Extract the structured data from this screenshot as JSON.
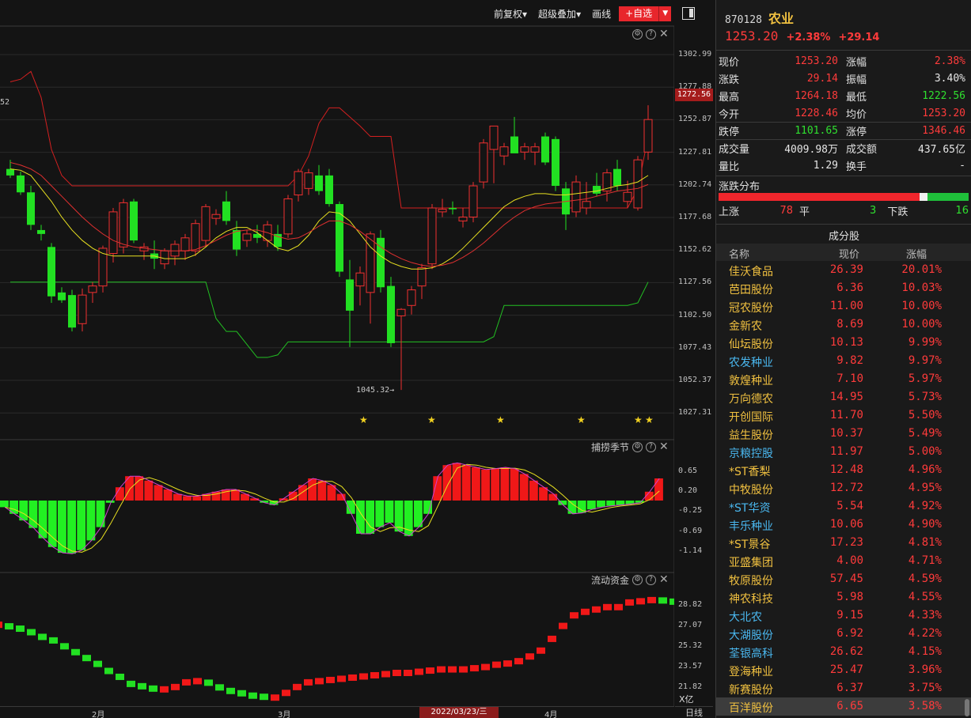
{
  "toolbar": {
    "restore_rights": "前复权",
    "overlay": "超级叠加",
    "draw_line": "画线",
    "add_favorite": "+自选"
  },
  "stock": {
    "code": "870128",
    "name": "农业",
    "price": "1253.20",
    "change_pct": "+2.38%",
    "change": "+29.14"
  },
  "quote": [
    {
      "k1": "现价",
      "v1": "1253.20",
      "c1": "red",
      "k2": "涨幅",
      "v2": "2.38%",
      "c2": "red",
      "div": false
    },
    {
      "k1": "涨跌",
      "v1": "29.14",
      "c1": "red",
      "k2": "振幅",
      "v2": "3.40%",
      "c2": "white",
      "div": false
    },
    {
      "k1": "最高",
      "v1": "1264.18",
      "c1": "red",
      "k2": "最低",
      "v2": "1222.56",
      "c2": "green",
      "div": false
    },
    {
      "k1": "今开",
      "v1": "1228.46",
      "c1": "red",
      "k2": "均价",
      "v2": "1253.20",
      "c2": "red",
      "div": false
    },
    {
      "k1": "跌停",
      "v1": "1101.65",
      "c1": "green",
      "k2": "涨停",
      "v2": "1346.46",
      "c2": "red",
      "div": true
    },
    {
      "k1": "成交量",
      "v1": "4009.98万",
      "c1": "white",
      "k2": "成交额",
      "v2": "437.65亿",
      "c2": "white",
      "div": true
    },
    {
      "k1": "量比",
      "v1": "1.29",
      "c1": "white",
      "k2": "换手",
      "v2": "-",
      "c2": "white",
      "div": false
    }
  ],
  "distribution": {
    "title": "涨跌分布",
    "up_label": "上涨",
    "up": 78,
    "flat_label": "平",
    "flat": 3,
    "down_label": "下跌",
    "down": 16
  },
  "constituents": {
    "title": "成分股",
    "headers": [
      "名称",
      "现价",
      "涨幅"
    ],
    "rows": [
      {
        "name": "佳沃食品",
        "price": "26.39",
        "chg": "20.01%",
        "blue": false
      },
      {
        "name": "芭田股份",
        "price": "6.36",
        "chg": "10.03%",
        "blue": false
      },
      {
        "name": "冠农股份",
        "price": "11.00",
        "chg": "10.00%",
        "blue": false
      },
      {
        "name": "金新农",
        "price": "8.69",
        "chg": "10.00%",
        "blue": false
      },
      {
        "name": "仙坛股份",
        "price": "10.13",
        "chg": "9.99%",
        "blue": false
      },
      {
        "name": "农发种业",
        "price": "9.82",
        "chg": "9.97%",
        "blue": true
      },
      {
        "name": "敦煌种业",
        "price": "7.10",
        "chg": "5.97%",
        "blue": false
      },
      {
        "name": "万向德农",
        "price": "14.95",
        "chg": "5.73%",
        "blue": false
      },
      {
        "name": "开创国际",
        "price": "11.70",
        "chg": "5.50%",
        "blue": false
      },
      {
        "name": "益生股份",
        "price": "10.37",
        "chg": "5.49%",
        "blue": false
      },
      {
        "name": "京粮控股",
        "price": "11.97",
        "chg": "5.00%",
        "blue": true
      },
      {
        "name": "*ST香梨",
        "price": "12.48",
        "chg": "4.96%",
        "blue": false
      },
      {
        "name": "中牧股份",
        "price": "12.72",
        "chg": "4.95%",
        "blue": false
      },
      {
        "name": "*ST华资",
        "price": "5.54",
        "chg": "4.92%",
        "blue": true
      },
      {
        "name": "丰乐种业",
        "price": "10.06",
        "chg": "4.90%",
        "blue": true
      },
      {
        "name": "*ST景谷",
        "price": "17.23",
        "chg": "4.81%",
        "blue": false
      },
      {
        "name": "亚盛集团",
        "price": "4.00",
        "chg": "4.71%",
        "blue": false
      },
      {
        "name": "牧原股份",
        "price": "57.45",
        "chg": "4.59%",
        "blue": false
      },
      {
        "name": "神农科技",
        "price": "5.98",
        "chg": "4.55%",
        "blue": false
      },
      {
        "name": "大北农",
        "price": "9.15",
        "chg": "4.33%",
        "blue": true
      },
      {
        "name": "大湖股份",
        "price": "6.92",
        "chg": "4.22%",
        "blue": true
      },
      {
        "name": "荃银高科",
        "price": "26.62",
        "chg": "4.15%",
        "blue": true
      },
      {
        "name": "登海种业",
        "price": "25.47",
        "chg": "3.96%",
        "blue": false
      },
      {
        "name": "新赛股份",
        "price": "6.37",
        "chg": "3.75%",
        "blue": false
      },
      {
        "name": "百洋股份",
        "price": "6.65",
        "chg": "3.58%",
        "blue": false
      }
    ]
  },
  "chart": {
    "price_axis": [
      "1302.99",
      "1277.88",
      "1252.87",
      "1227.81",
      "1202.74",
      "1177.68",
      "1152.62",
      "1127.56",
      "1102.50",
      "1077.43",
      "1052.37",
      "1027.31"
    ],
    "current_price_tag": "1272.56",
    "low_annotation": "1045.32",
    "left_annotation": "52",
    "macd_label": "捕捞季节",
    "macd_axis": [
      "0.65",
      "0.20",
      "-0.25",
      "-0.69",
      "-1.14"
    ],
    "flow_label": "流动资金",
    "flow_axis": [
      "28.82",
      "27.07",
      "25.32",
      "23.57",
      "21.82"
    ],
    "flow_unit": "X亿",
    "x_labels": [
      "2月",
      "3月",
      "4月"
    ],
    "cursor_date": "2022/03/23/三",
    "period": "日线"
  },
  "chart_data": {
    "type": "candlestick",
    "ylim": [
      1020,
      1310
    ],
    "candles": [
      [
        1215,
        1222,
        1208,
        1210
      ],
      [
        1210,
        1213,
        1195,
        1197
      ],
      [
        1197,
        1202,
        1168,
        1172
      ],
      [
        1168,
        1172,
        1160,
        1165
      ],
      [
        1155,
        1158,
        1112,
        1117
      ],
      [
        1120,
        1124,
        1112,
        1114
      ],
      [
        1118,
        1122,
        1090,
        1093
      ],
      [
        1096,
        1123,
        1090,
        1118
      ],
      [
        1120,
        1128,
        1112,
        1125
      ],
      [
        1125,
        1156,
        1120,
        1154
      ],
      [
        1150,
        1185,
        1143,
        1182
      ],
      [
        1155,
        1192,
        1150,
        1189
      ],
      [
        1190,
        1192,
        1158,
        1160
      ],
      [
        1152,
        1158,
        1145,
        1155
      ],
      [
        1150,
        1160,
        1138,
        1146
      ],
      [
        1142,
        1154,
        1138,
        1152
      ],
      [
        1148,
        1160,
        1141,
        1157
      ],
      [
        1152,
        1165,
        1145,
        1162
      ],
      [
        1152,
        1176,
        1148,
        1173
      ],
      [
        1160,
        1188,
        1155,
        1186
      ],
      [
        1177,
        1184,
        1172,
        1180
      ],
      [
        1190,
        1198,
        1172,
        1175
      ],
      [
        1168,
        1175,
        1148,
        1153
      ],
      [
        1160,
        1168,
        1155,
        1165
      ],
      [
        1165,
        1172,
        1158,
        1162
      ],
      [
        1160,
        1175,
        1155,
        1172
      ],
      [
        1165,
        1172,
        1152,
        1155
      ],
      [
        1165,
        1195,
        1162,
        1192
      ],
      [
        1195,
        1215,
        1190,
        1213
      ],
      [
        1200,
        1215,
        1195,
        1212
      ],
      [
        1210,
        1218,
        1195,
        1198
      ],
      [
        1210,
        1215,
        1186,
        1188
      ],
      [
        1188,
        1190,
        1132,
        1136
      ],
      [
        1130,
        1145,
        1078,
        1106
      ],
      [
        1125,
        1140,
        1110,
        1135
      ],
      [
        1120,
        1167,
        1096,
        1165
      ],
      [
        1162,
        1168,
        1120,
        1124
      ],
      [
        1125,
        1132,
        1078,
        1081
      ],
      [
        1102,
        1108,
        1045,
        1107
      ],
      [
        1110,
        1125,
        1103,
        1122
      ],
      [
        1125,
        1142,
        1115,
        1139
      ],
      [
        1142,
        1188,
        1138,
        1185
      ],
      [
        1182,
        1192,
        1178,
        1184
      ],
      [
        1185,
        1190,
        1180,
        1184
      ],
      [
        1175,
        1185,
        1170,
        1178
      ],
      [
        1178,
        1205,
        1174,
        1202
      ],
      [
        1205,
        1238,
        1200,
        1235
      ],
      [
        1230,
        1245,
        1204,
        1248
      ],
      [
        1225,
        1235,
        1218,
        1232
      ],
      [
        1240,
        1255,
        1235,
        1227
      ],
      [
        1228,
        1235,
        1222,
        1232
      ],
      [
        1228,
        1235,
        1218,
        1232
      ],
      [
        1240,
        1243,
        1218,
        1220
      ],
      [
        1238,
        1240,
        1198,
        1202
      ],
      [
        1200,
        1205,
        1168,
        1180
      ],
      [
        1182,
        1210,
        1178,
        1205
      ],
      [
        1185,
        1205,
        1180,
        1190
      ],
      [
        1202,
        1212,
        1194,
        1196
      ],
      [
        1198,
        1215,
        1190,
        1212
      ],
      [
        1215,
        1222,
        1198,
        1202
      ],
      [
        1190,
        1206,
        1185,
        1197
      ],
      [
        1185,
        1225,
        1183,
        1222
      ],
      [
        1228,
        1264,
        1222,
        1253
      ]
    ],
    "ma_yellow": [
      1215,
      1214,
      1210,
      1200,
      1190,
      1178,
      1168,
      1160,
      1154,
      1150,
      1148,
      1148,
      1148,
      1148,
      1148,
      1146,
      1146,
      1146,
      1149,
      1155,
      1162,
      1167,
      1170,
      1170,
      1166,
      1160,
      1154,
      1152,
      1156,
      1164,
      1175,
      1182,
      1181,
      1175,
      1165,
      1155,
      1148,
      1143,
      1140,
      1138,
      1138,
      1139,
      1142,
      1147,
      1154,
      1162,
      1170,
      1178,
      1186,
      1191,
      1194,
      1196,
      1196,
      1195,
      1195,
      1196,
      1197,
      1198,
      1200,
      1202,
      1203,
      1205,
      1210
    ],
    "ma_red": [
      1220,
      1218,
      1215,
      1210,
      1202,
      1194,
      1186,
      1178,
      1171,
      1165,
      1160,
      1157,
      1155,
      1154,
      1153,
      1152,
      1152,
      1152,
      1153,
      1156,
      1160,
      1164,
      1167,
      1168,
      1168,
      1166,
      1163,
      1161,
      1162,
      1166,
      1171,
      1175,
      1175,
      1172,
      1167,
      1161,
      1155,
      1150,
      1146,
      1143,
      1141,
      1140,
      1141,
      1143,
      1147,
      1152,
      1158,
      1165,
      1172,
      1178,
      1183,
      1186,
      1188,
      1189,
      1190,
      1191,
      1192,
      1194,
      1196,
      1198,
      1199,
      1200,
      1203
    ]
  }
}
